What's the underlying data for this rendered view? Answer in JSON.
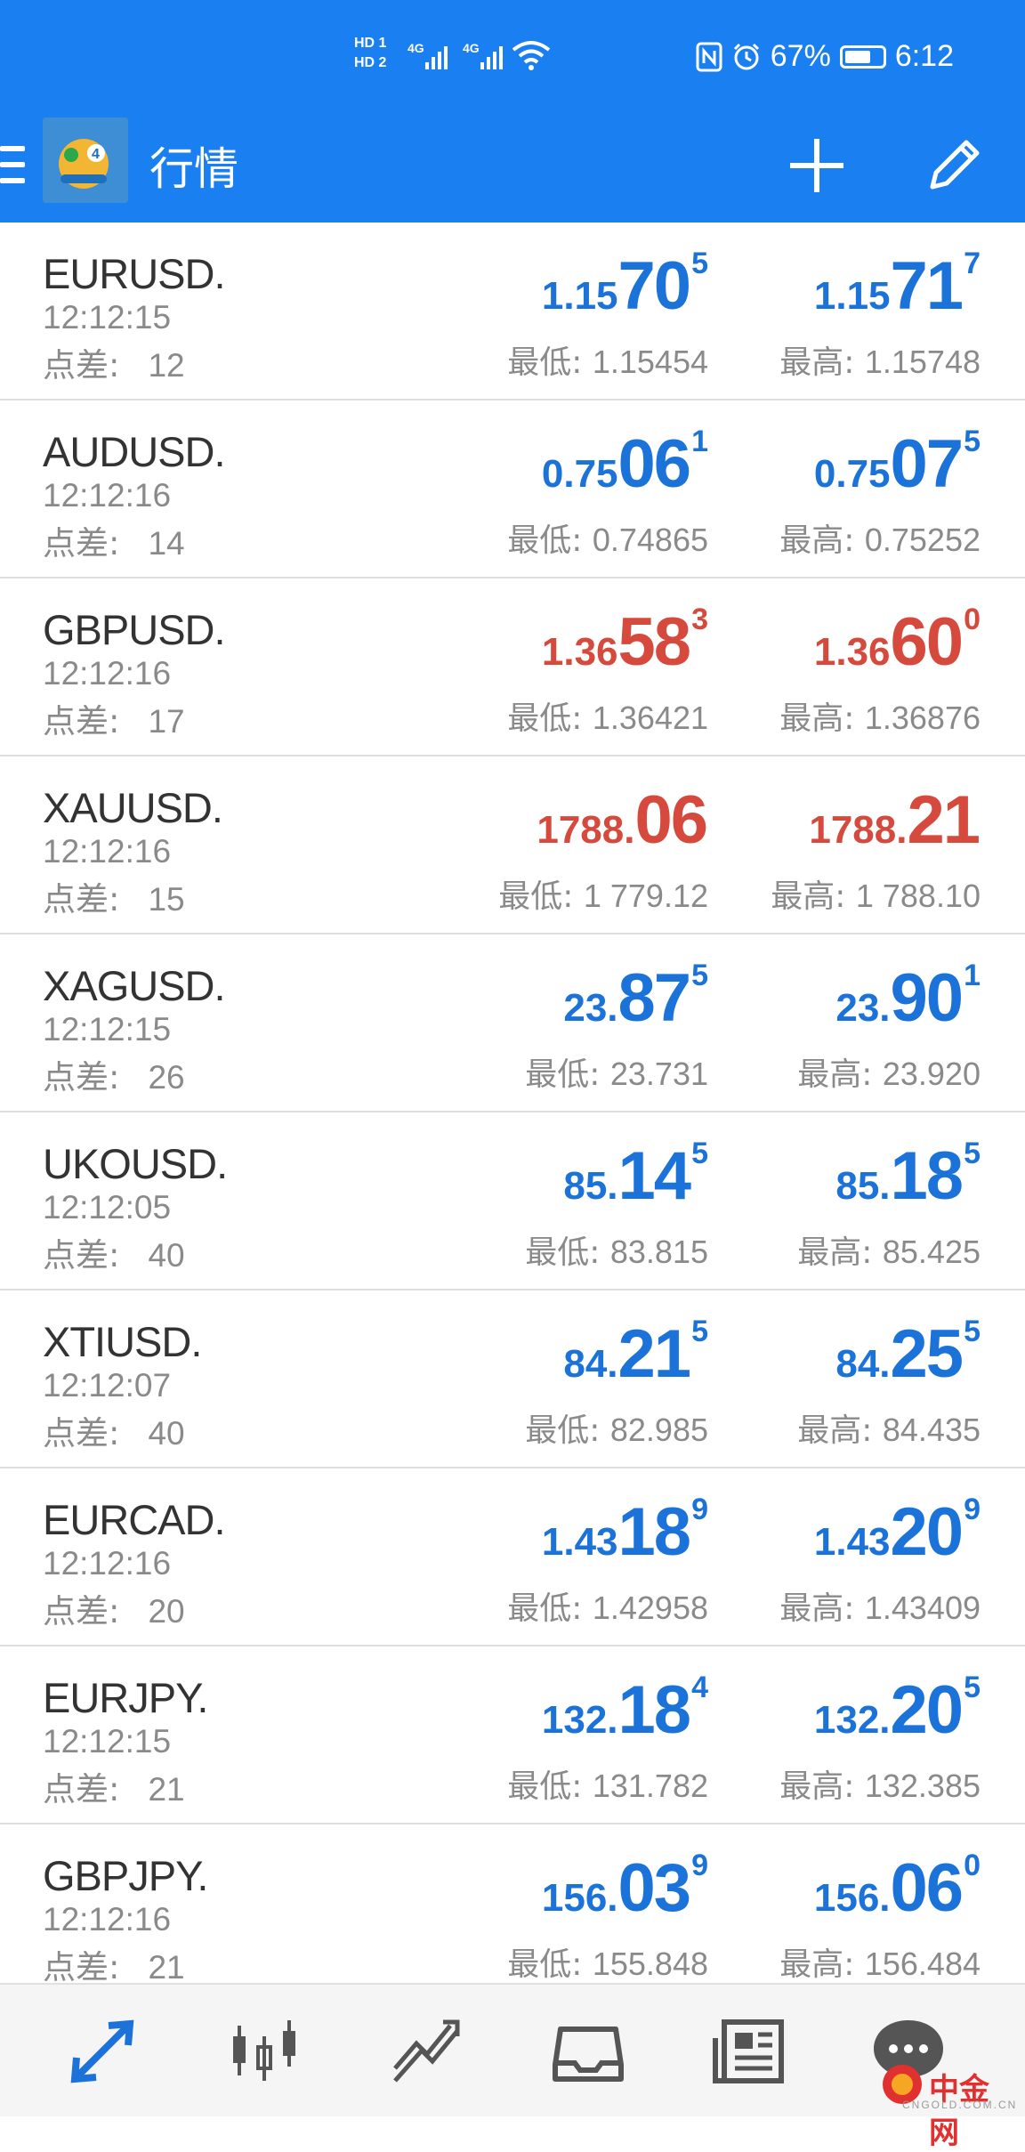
{
  "status_bar": {
    "hd1": "HD 1",
    "hd2": "HD 2",
    "sig1": "4G",
    "sig2": "4G",
    "battery": "67%",
    "time": "6:12"
  },
  "app_bar": {
    "title": "行情"
  },
  "quotes": [
    {
      "symbol": "EURUSD.",
      "time": "12:12:15",
      "spread_label": "点差:",
      "spread": "12",
      "bid": {
        "small": "1.15",
        "big": "70",
        "sup": "5"
      },
      "ask": {
        "small": "1.15",
        "big": "71",
        "sup": "7"
      },
      "low_label": "最低:",
      "low": "1.15454",
      "high_label": "最高:",
      "high": "1.15748",
      "color": "blue"
    },
    {
      "symbol": "AUDUSD.",
      "time": "12:12:16",
      "spread_label": "点差:",
      "spread": "14",
      "bid": {
        "small": "0.75",
        "big": "06",
        "sup": "1"
      },
      "ask": {
        "small": "0.75",
        "big": "07",
        "sup": "5"
      },
      "low_label": "最低:",
      "low": "0.74865",
      "high_label": "最高:",
      "high": "0.75252",
      "color": "blue"
    },
    {
      "symbol": "GBPUSD.",
      "time": "12:12:16",
      "spread_label": "点差:",
      "spread": "17",
      "bid": {
        "small": "1.36",
        "big": "58",
        "sup": "3"
      },
      "ask": {
        "small": "1.36",
        "big": "60",
        "sup": "0"
      },
      "low_label": "最低:",
      "low": "1.36421",
      "high_label": "最高:",
      "high": "1.36876",
      "color": "red"
    },
    {
      "symbol": "XAUUSD.",
      "time": "12:12:16",
      "spread_label": "点差:",
      "spread": "15",
      "bid": {
        "small": "1788.",
        "big": "06",
        "sup": ""
      },
      "ask": {
        "small": "1788.",
        "big": "21",
        "sup": ""
      },
      "low_label": "最低:",
      "low": "1 779.12",
      "high_label": "最高:",
      "high": "1 788.10",
      "color": "red"
    },
    {
      "symbol": "XAGUSD.",
      "time": "12:12:15",
      "spread_label": "点差:",
      "spread": "26",
      "bid": {
        "small": "23.",
        "big": "87",
        "sup": "5"
      },
      "ask": {
        "small": "23.",
        "big": "90",
        "sup": "1"
      },
      "low_label": "最低:",
      "low": "23.731",
      "high_label": "最高:",
      "high": "23.920",
      "color": "blue"
    },
    {
      "symbol": "UKOUSD.",
      "time": "12:12:05",
      "spread_label": "点差:",
      "spread": "40",
      "bid": {
        "small": "85.",
        "big": "14",
        "sup": "5"
      },
      "ask": {
        "small": "85.",
        "big": "18",
        "sup": "5"
      },
      "low_label": "最低:",
      "low": "83.815",
      "high_label": "最高:",
      "high": "85.425",
      "color": "blue"
    },
    {
      "symbol": "XTIUSD.",
      "time": "12:12:07",
      "spread_label": "点差:",
      "spread": "40",
      "bid": {
        "small": "84.",
        "big": "21",
        "sup": "5"
      },
      "ask": {
        "small": "84.",
        "big": "25",
        "sup": "5"
      },
      "low_label": "最低:",
      "low": "82.985",
      "high_label": "最高:",
      "high": "84.435",
      "color": "blue"
    },
    {
      "symbol": "EURCAD.",
      "time": "12:12:16",
      "spread_label": "点差:",
      "spread": "20",
      "bid": {
        "small": "1.43",
        "big": "18",
        "sup": "9"
      },
      "ask": {
        "small": "1.43",
        "big": "20",
        "sup": "9"
      },
      "low_label": "最低:",
      "low": "1.42958",
      "high_label": "最高:",
      "high": "1.43409",
      "color": "blue"
    },
    {
      "symbol": "EURJPY.",
      "time": "12:12:15",
      "spread_label": "点差:",
      "spread": "21",
      "bid": {
        "small": "132.",
        "big": "18",
        "sup": "4"
      },
      "ask": {
        "small": "132.",
        "big": "20",
        "sup": "5"
      },
      "low_label": "最低:",
      "low": "131.782",
      "high_label": "最高:",
      "high": "132.385",
      "color": "blue"
    },
    {
      "symbol": "GBPJPY.",
      "time": "12:12:16",
      "spread_label": "点差:",
      "spread": "21",
      "bid": {
        "small": "156.",
        "big": "03",
        "sup": "9"
      },
      "ask": {
        "small": "156.",
        "big": "06",
        "sup": "0"
      },
      "low_label": "最低:",
      "low": "155.848",
      "high_label": "最高:",
      "high": "156.484",
      "color": "blue"
    }
  ],
  "colors": {
    "blue": "#1b72d8",
    "red": "#d64a3e",
    "appbar": "#1a7ff0"
  },
  "bottom_nav": [
    "quotes-icon",
    "chart-icon",
    "trade-icon",
    "history-icon",
    "news-icon",
    "messages-icon"
  ],
  "watermark": {
    "text": "中金网",
    "sub": "CNGOLD.COM.CN"
  }
}
